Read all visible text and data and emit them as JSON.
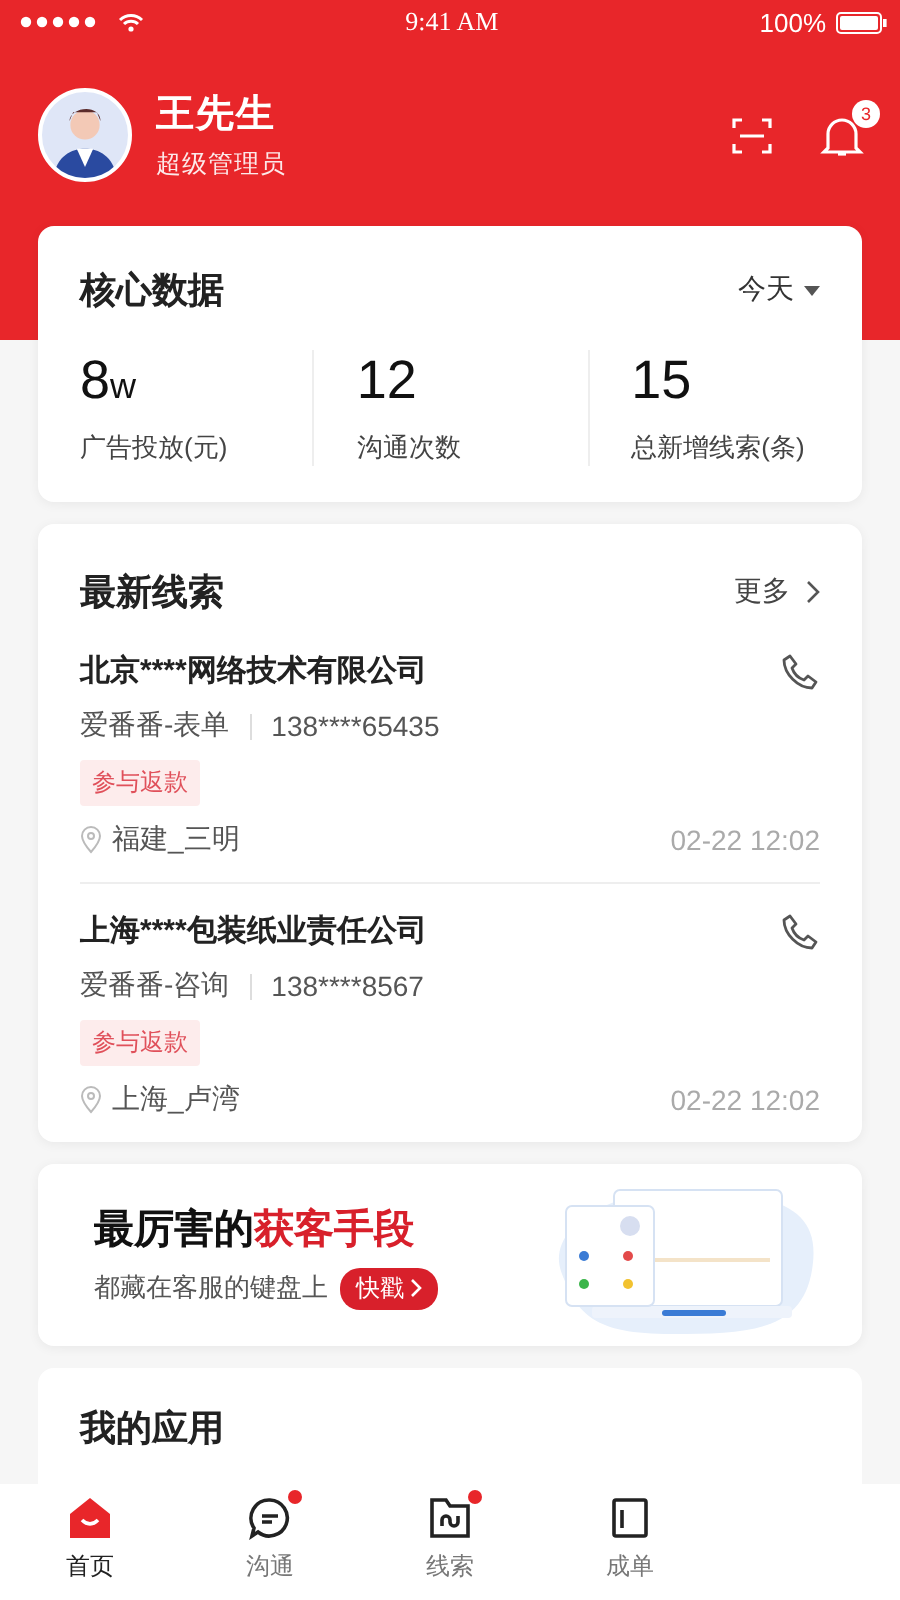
{
  "status_bar": {
    "time": "9:41 AM",
    "battery": "100%"
  },
  "profile": {
    "name": "王先生",
    "role": "超级管理员",
    "notification_count": "3"
  },
  "core_data": {
    "title": "核心数据",
    "period": "今天",
    "stats": [
      {
        "value": "8",
        "unit": "w",
        "label": "广告投放(元)"
      },
      {
        "value": "12",
        "label": "沟通次数"
      },
      {
        "value": "15",
        "label": "总新增线索(条)"
      }
    ]
  },
  "leads": {
    "title": "最新线索",
    "more": "更多",
    "items": [
      {
        "company": "北京****网络技术有限公司",
        "source": "爱番番-表单",
        "phone": "138****65435",
        "tag": "参与返款",
        "location": "福建_三明",
        "time": "02-22 12:02"
      },
      {
        "company": "上海****包装纸业责任公司",
        "source": "爱番番-咨询",
        "phone": "138****8567",
        "tag": "参与返款",
        "location": "上海_卢湾",
        "time": "02-22 12:02"
      }
    ]
  },
  "promo": {
    "title": "最厉害的",
    "title_highlight": "获客手段",
    "subtitle": "都藏在客服的键盘上",
    "button": "快戳"
  },
  "apps": {
    "title": "我的应用"
  },
  "tabs": [
    {
      "kind": "home",
      "label": "首页",
      "selected": true,
      "dot": false
    },
    {
      "kind": "chat",
      "label": "沟通",
      "selected": false,
      "dot": true
    },
    {
      "kind": "folder",
      "label": "线索",
      "selected": false,
      "dot": true
    },
    {
      "kind": "doc",
      "label": "成单",
      "selected": false,
      "dot": false
    }
  ]
}
